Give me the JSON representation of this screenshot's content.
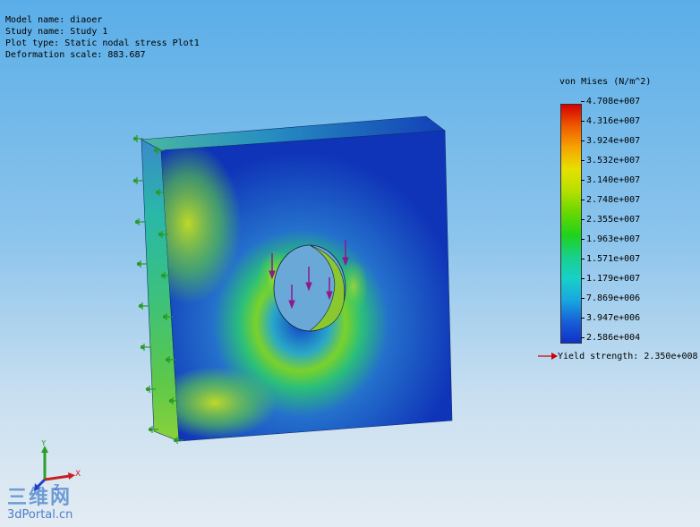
{
  "info": {
    "model_name": "Model name: diaoer",
    "study_name": "Study name: Study 1",
    "plot_type": "Plot type: Static nodal stress Plot1",
    "deformation": "Deformation scale: 883.687"
  },
  "legend": {
    "title": "von Mises (N/m^2)",
    "ticks": [
      "4.708e+007",
      "4.316e+007",
      "3.924e+007",
      "3.532e+007",
      "3.140e+007",
      "2.748e+007",
      "2.355e+007",
      "1.963e+007",
      "1.571e+007",
      "1.179e+007",
      "7.869e+006",
      "3.947e+006",
      "2.586e+004"
    ],
    "yield_label": "Yield strength:",
    "yield_value": "2.350e+008"
  },
  "triad": {
    "x": "X",
    "y": "Y",
    "z": "Z"
  },
  "watermark": {
    "chinese": "三维网",
    "url": "3dPortal.cn"
  },
  "colors": {
    "max": "#d40000",
    "min": "#1030c8",
    "load": "#8b1a8b",
    "fixture": "#2a9a2a",
    "yield_arrow": "#cc0000"
  }
}
